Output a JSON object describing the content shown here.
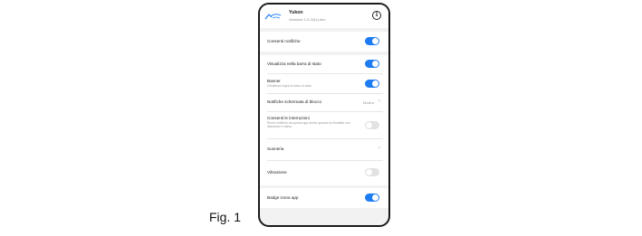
{
  "figure_label": "Fig. 1",
  "app": {
    "name": "Yukon",
    "version": "Versione 1.0.16(1)-dev",
    "logo_icon": "app-logo-icon",
    "info_icon": "info-icon",
    "info_glyph": "i"
  },
  "settings": {
    "consenti_notifiche": {
      "label": "Consenti notifiche",
      "enabled": true
    },
    "barra_stato": {
      "label": "Visualizza nella barra di stato",
      "enabled": true
    },
    "banner": {
      "label": "Banner",
      "sublabel": "Visualizza sopra la barra di stato",
      "enabled": true
    },
    "schermata_blocco": {
      "label": "Notifiche schermata di blocco",
      "value": "Mostra"
    },
    "interruzioni": {
      "label": "Consenti le interruzioni",
      "sublabel": "Ricevi notifiche da questa app anche quando la Modalità non disturbare è attiva",
      "enabled": false
    },
    "suoneria": {
      "label": "Suoneria"
    },
    "vibrazione": {
      "label": "Vibrazione",
      "enabled": false
    },
    "badge": {
      "label": "Badge icona app",
      "enabled": true
    }
  },
  "colors": {
    "toggle_on": "#1e7cf2",
    "toggle_off": "#e2e2e2",
    "background": "#f2f2f2"
  },
  "chevron_glyph": "›"
}
